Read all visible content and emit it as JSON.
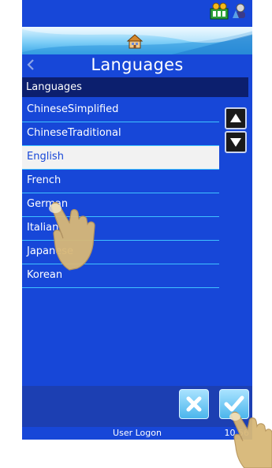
{
  "screen": {
    "title": "Languages",
    "list_header": "Languages",
    "languages": [
      {
        "label": "ChineseSimplified",
        "selected": false
      },
      {
        "label": "ChineseTraditional",
        "selected": false
      },
      {
        "label": "English",
        "selected": true
      },
      {
        "label": "French",
        "selected": false
      },
      {
        "label": "German",
        "selected": false
      },
      {
        "label": "Italian",
        "selected": false
      },
      {
        "label": "Japanese",
        "selected": false
      },
      {
        "label": "Korean",
        "selected": false
      }
    ]
  },
  "footer": {
    "user": "User Logon",
    "time": "10 56"
  },
  "icons": {
    "back": "chevron-left-icon",
    "home": "home-icon",
    "scroll_up": "arrow-up-icon",
    "scroll_down": "arrow-down-icon",
    "cancel": "close-icon",
    "confirm": "check-icon"
  },
  "colors": {
    "background": "#1747d8",
    "list_header": "#0c1f6e",
    "divider": "#3fc2ff",
    "selected_row": "#f2f2f2"
  }
}
